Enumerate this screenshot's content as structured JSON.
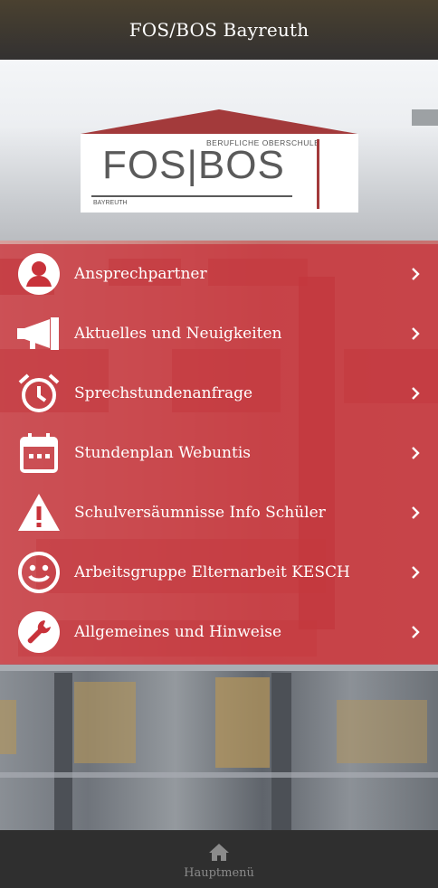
{
  "header": {
    "title": "FOS/BOS Bayreuth"
  },
  "logo": {
    "subtitle": "BERUFLICHE OBERSCHULE",
    "main": "FOS|BOS",
    "city": "BAYREUTH"
  },
  "menu": {
    "items": [
      {
        "label": "Ansprechpartner",
        "icon": "person-icon"
      },
      {
        "label": "Aktuelles und Neuigkeiten",
        "icon": "megaphone-icon"
      },
      {
        "label": "Sprechstundenanfrage",
        "icon": "alarm-clock-icon"
      },
      {
        "label": "Stundenplan Webuntis",
        "icon": "calendar-icon"
      },
      {
        "label": "Schulversäumnisse Info Schüler",
        "icon": "warning-icon"
      },
      {
        "label": "Arbeitsgruppe Elternarbeit KESCH",
        "icon": "smiley-icon"
      },
      {
        "label": "Allgemeines und Hinweise",
        "icon": "wrench-icon"
      }
    ]
  },
  "bottom_nav": {
    "home_label": "Hauptmenü"
  },
  "colors": {
    "accent": "#c8323a",
    "header": "#3a3632",
    "bottom": "#2f2f2f"
  }
}
